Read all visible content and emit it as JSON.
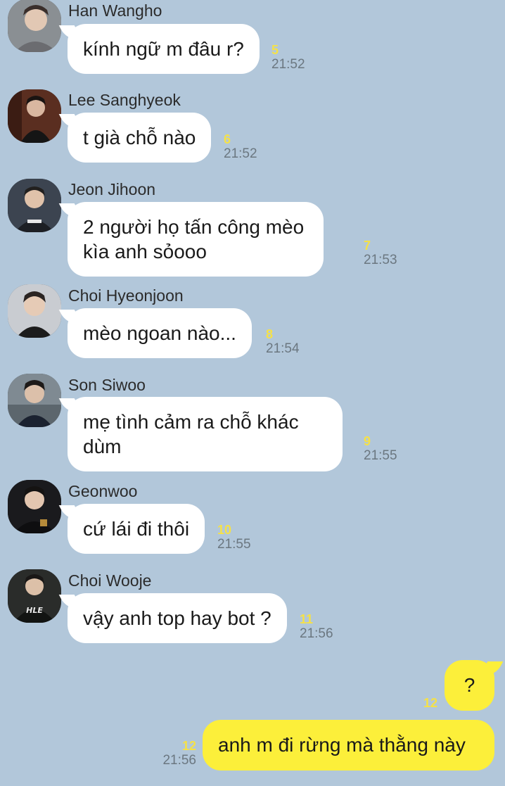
{
  "messages": [
    {
      "sender": "Han Wangho",
      "text": "kính ngữ m đâu r?",
      "unread": "5",
      "time": "21:52"
    },
    {
      "sender": "Lee Sanghyeok",
      "text": "t già chỗ nào",
      "unread": "6",
      "time": "21:52"
    },
    {
      "sender": "Jeon Jihoon",
      "text_line1": "2 người họ tấn công mèo",
      "text_line2": "kìa anh sỏooo",
      "unread": "7",
      "time": "21:53"
    },
    {
      "sender": "Choi Hyeonjoon",
      "text": "mèo ngoan nào...",
      "unread": "8",
      "time": "21:54"
    },
    {
      "sender": "Son Siwoo",
      "text_line1": "mẹ tình cảm ra chỗ khác",
      "text_line2": "dùm",
      "unread": "9",
      "time": "21:55"
    },
    {
      "sender": "Geonwoo",
      "text": "cứ lái đi thôi",
      "unread": "10",
      "time": "21:55"
    },
    {
      "sender": "Choi Wooje",
      "text": "vậy anh top hay bot ?",
      "unread": "11",
      "time": "21:56"
    }
  ],
  "mine": [
    {
      "text": "?",
      "unread": "12"
    },
    {
      "text": "anh m đi rừng mà thằng này",
      "unread": "12",
      "time": "21:56"
    }
  ],
  "colors": {
    "background": "#b2c7da",
    "my_bubble": "#fcef3a",
    "their_bubble": "#ffffff",
    "unread": "#f5e148"
  }
}
